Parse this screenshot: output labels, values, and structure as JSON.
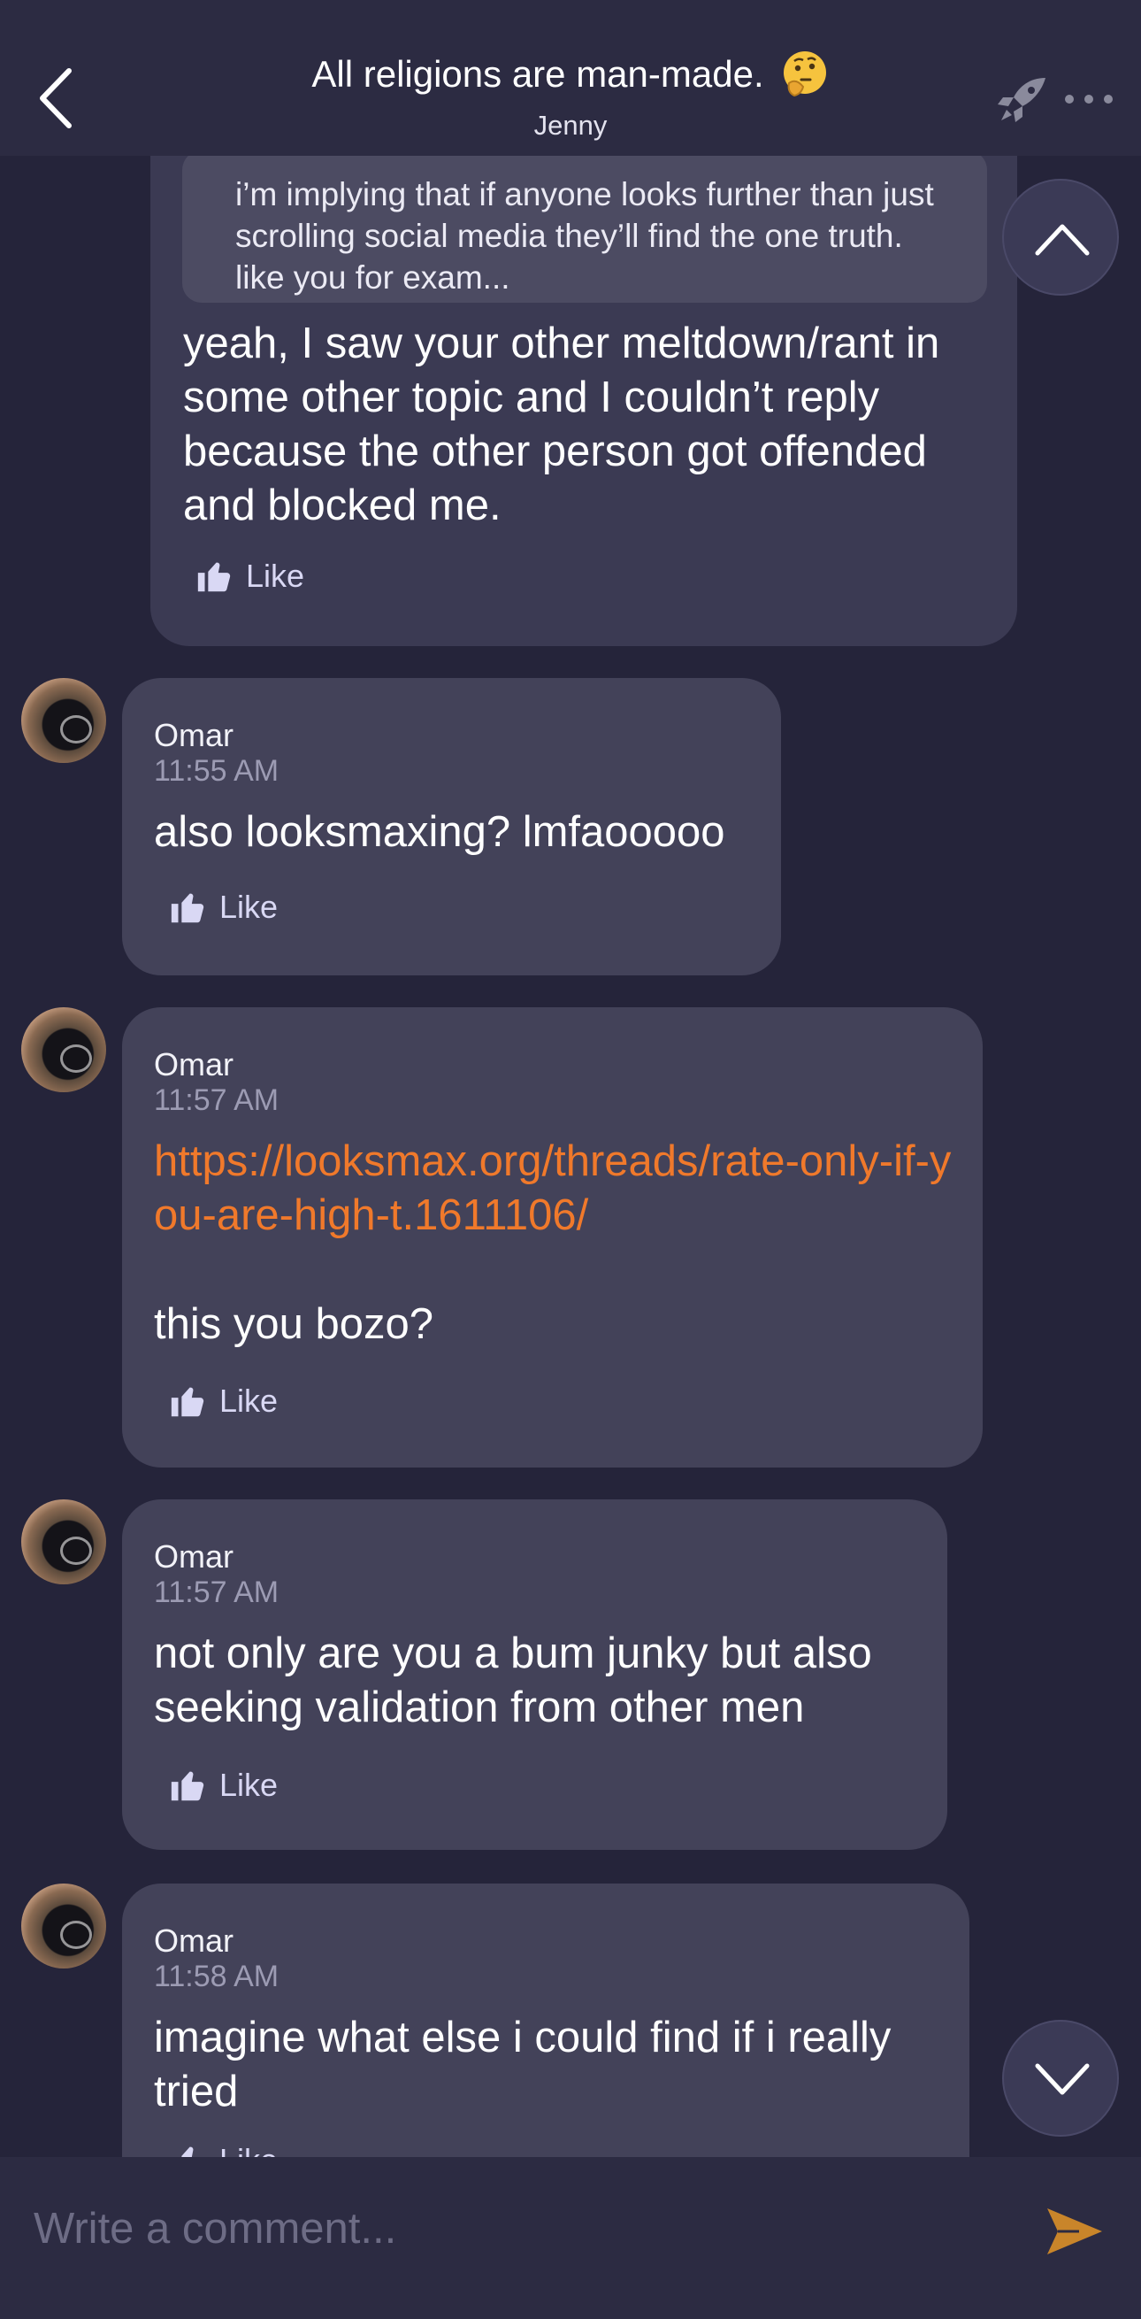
{
  "header": {
    "title": "All religions are man-made.",
    "title_emoji": "thinking-face-icon",
    "subtitle": "Jenny"
  },
  "colors": {
    "background": "#25243a",
    "bubble": "#434259",
    "link": "#f0792b",
    "send": "#c9852a",
    "like": "#d9d8f4"
  },
  "messages": [
    {
      "quote": "i’m implying that if anyone looks further than just scrolling social media they’ll find the one truth. like you for exam...",
      "text": "yeah, I saw your other meltdown/rant in some other topic and I couldn’t reply because the other person got offended and blocked me.",
      "like": "Like"
    },
    {
      "sender": "Omar",
      "time": "11:55 AM",
      "text": "also looksmaxing? lmfaooooo",
      "like": "Like"
    },
    {
      "sender": "Omar",
      "time": "11:57 AM",
      "link": "https://looksmax.org/threads/rate-only-if-you-are-high-t.1611106/",
      "text": "this you bozo?",
      "like": "Like"
    },
    {
      "sender": "Omar",
      "time": "11:57 AM",
      "text": "not only are you a bum junky but also seeking validation from other men",
      "like": "Like"
    },
    {
      "sender": "Omar",
      "time": "11:58 AM",
      "text": "imagine what else i could find if i really tried",
      "like": "Like"
    }
  ],
  "composer": {
    "placeholder": "Write a comment..."
  },
  "icons": [
    "back-chevron-icon",
    "thinking-face-icon",
    "rocket-icon",
    "more-dots-icon",
    "thumbs-up-icon",
    "chevron-up-icon",
    "chevron-down-icon",
    "send-icon"
  ]
}
